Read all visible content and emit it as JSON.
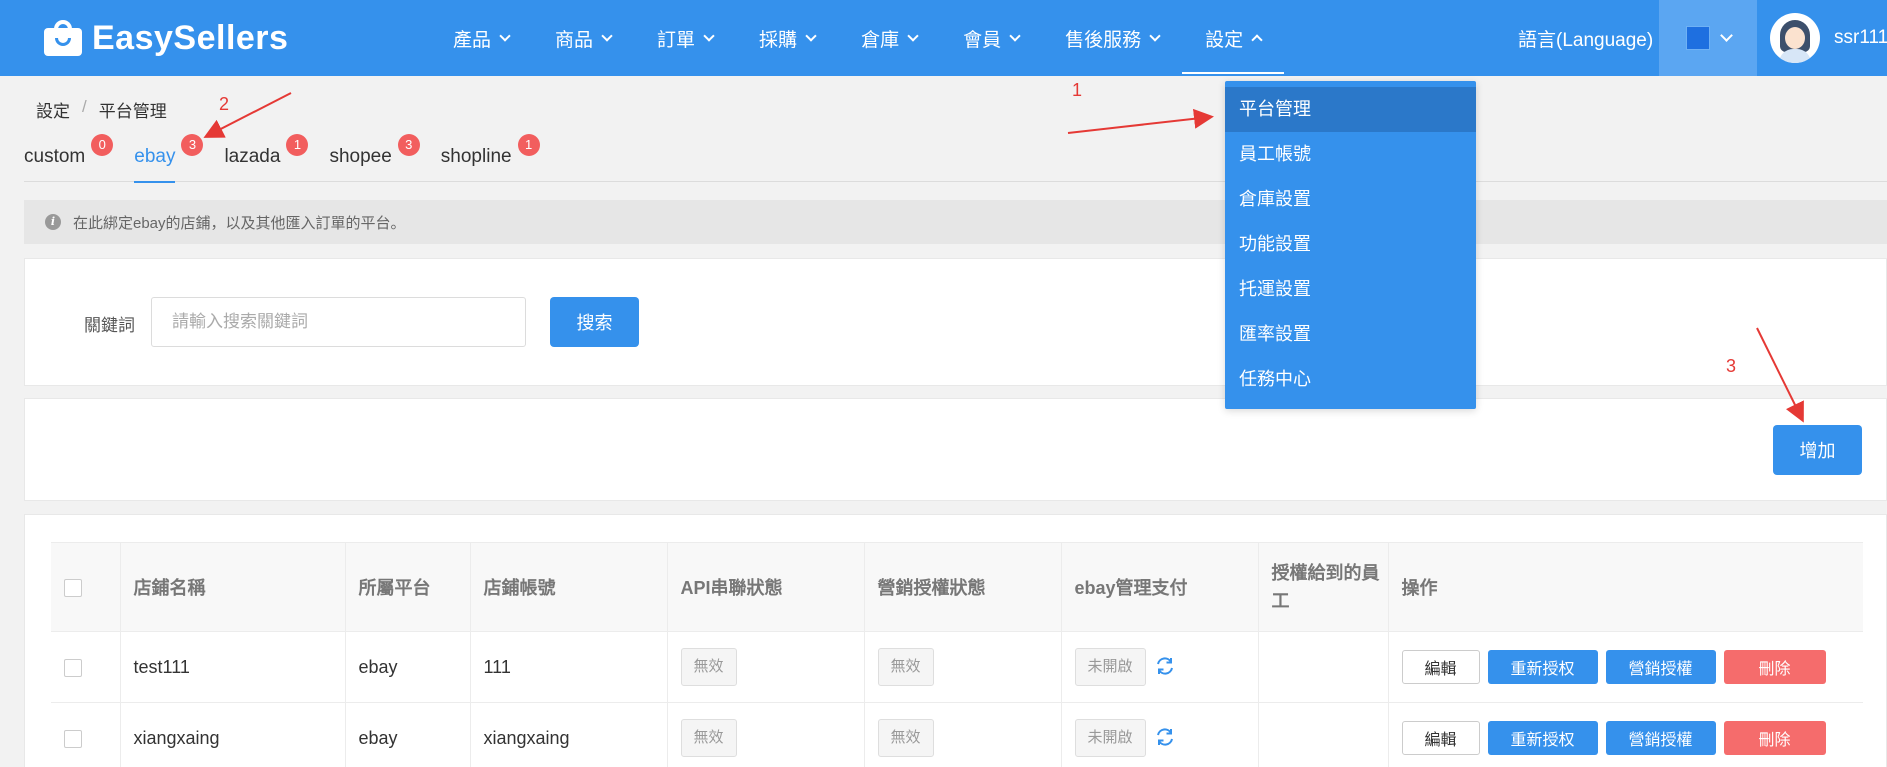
{
  "header": {
    "logo_text": "EasySellers",
    "nav": [
      {
        "label": "產品"
      },
      {
        "label": "商品"
      },
      {
        "label": "訂單"
      },
      {
        "label": "採購"
      },
      {
        "label": "倉庫"
      },
      {
        "label": "會員"
      },
      {
        "label": "售後服務"
      },
      {
        "label": "設定"
      }
    ],
    "language": "語言(Language)",
    "username": "ssr111",
    "theme_color": "#1e6fe0"
  },
  "settings_menu": [
    "平台管理",
    "員工帳號",
    "倉庫設置",
    "功能設置",
    "托運設置",
    "匯率設置",
    "任務中心"
  ],
  "breadcrumb": [
    "設定",
    "平台管理"
  ],
  "tabs": [
    {
      "label": "custom",
      "count": "0"
    },
    {
      "label": "ebay",
      "count": "3"
    },
    {
      "label": "lazada",
      "count": "1"
    },
    {
      "label": "shopee",
      "count": "3"
    },
    {
      "label": "shopline",
      "count": "1"
    }
  ],
  "info_text": "在此綁定ebay的店鋪，以及其他匯入訂單的平台。",
  "search": {
    "label": "關鍵詞",
    "placeholder": "請輸入搜索關鍵詞",
    "button": "搜索"
  },
  "add_button": "增加",
  "table": {
    "headers": [
      "店鋪名稱",
      "所屬平台",
      "店鋪帳號",
      "API串聯狀態",
      "營銷授權狀態",
      "ebay管理支付",
      "授權給到的員工",
      "操作"
    ],
    "rows": [
      {
        "name": "test111",
        "platform": "ebay",
        "account": "111",
        "api": "無效",
        "marketing": "無效",
        "payment": "未開啟"
      },
      {
        "name": "xiangxaing",
        "platform": "ebay",
        "account": "xiangxaing",
        "api": "無效",
        "marketing": "無效",
        "payment": "未開啟"
      }
    ],
    "actions": {
      "edit": "編輯",
      "reauth": "重新授权",
      "marketing_auth": "營銷授權",
      "delete": "刪除"
    }
  },
  "annotations": [
    "1",
    "2",
    "3"
  ]
}
